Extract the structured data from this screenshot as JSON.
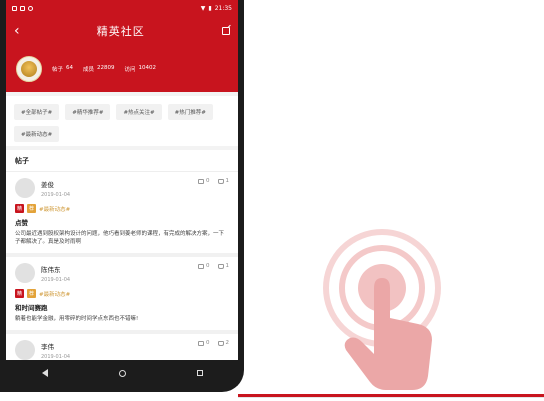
{
  "status": {
    "time": "21:35"
  },
  "header": {
    "title": "精英社区"
  },
  "profile": {
    "posts_label": "帖子",
    "posts_value": "64",
    "score_label": "成员",
    "score_value": "22809",
    "visits_label": "访问",
    "visits_value": "10402"
  },
  "tags": [
    "#全部帖子#",
    "#精华推荐#",
    "#热点关注#",
    "#热门推荐#",
    "#最新动态#"
  ],
  "section_title": "帖子",
  "posts": [
    {
      "name": "姜俊",
      "date": "2019-01-04",
      "comments": "0",
      "likes": "1",
      "badge1": "精",
      "badge2": "荐",
      "tag": "#最新动态#",
      "title": "点赞",
      "text": "公司最近遇到股权架构设计的问题，他巧看到姜老师的课程，有完成的解决方案，一下子都解决了。真是及时雨啊"
    },
    {
      "name": "陈伟东",
      "date": "2019-01-04",
      "comments": "0",
      "likes": "1",
      "badge1": "精",
      "badge2": "荐",
      "tag": "#最新动态#",
      "title": "和时间赛跑",
      "text": "躺着也能学金融，用零碎的时间学点东西也不错嘛!"
    },
    {
      "name": "李伟",
      "date": "2019-01-04",
      "comments": "0",
      "likes": "2"
    }
  ],
  "colors": {
    "brand": "#c8141e",
    "accent": "#e3a33a"
  }
}
